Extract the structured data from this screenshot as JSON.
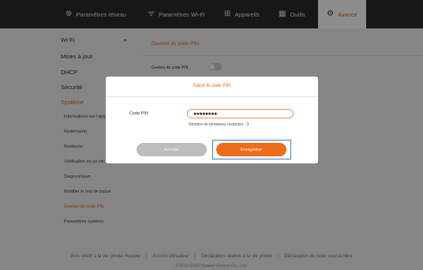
{
  "nav": {
    "tabs": [
      {
        "label": "Paramètres réseau",
        "icon": "globe-icon",
        "glyph": "⊕"
      },
      {
        "label": "Paramètres Wi-Fi",
        "icon": "wifi-icon",
        "glyph": "ᯤ"
      },
      {
        "label": "Appareils",
        "icon": "devices-icon",
        "glyph": "⊞"
      },
      {
        "label": "Outils",
        "icon": "tools-icon",
        "glyph": "▦"
      },
      {
        "label": "Avancé",
        "icon": "gear-icon",
        "glyph": "⚙",
        "active": true
      }
    ]
  },
  "sidebar": {
    "items": [
      "Wi-Fi",
      "Mises à jour",
      "DHCP",
      "Sécurité",
      "Système"
    ],
    "subitems": [
      "Informations sur l'appareil",
      "Redémarrer",
      "Restaurer",
      "Vérification en un clic",
      "Diagnostiquer",
      "Modifier le mot de passe",
      "Gestion du code PIN",
      "Paramètres système"
    ]
  },
  "content": {
    "title": "Gestion du code PIN",
    "toggle_label": "Gestion du code PIN"
  },
  "dialog": {
    "title": "Saisir le code PIN",
    "pin_label": "Code PIN",
    "pin_value": "●●●●●●●●",
    "attempts_text": "Nombre de tentatives restantes : 3",
    "cancel_label": "Annuler",
    "save_label": "Enregistrer"
  },
  "footer": {
    "links": [
      "Avis relatif à la vie privée Huawei",
      "Accord utilisateur",
      "Déclaration relative à la vie privée",
      "Déclaration de code source libre"
    ],
    "copyright": "©2017-2020 Huawei Device Co., Ltd."
  },
  "colors": {
    "accent": "#e46c1a",
    "nav_bg": "#2b2b2b",
    "focus": "#3b7fcb"
  }
}
